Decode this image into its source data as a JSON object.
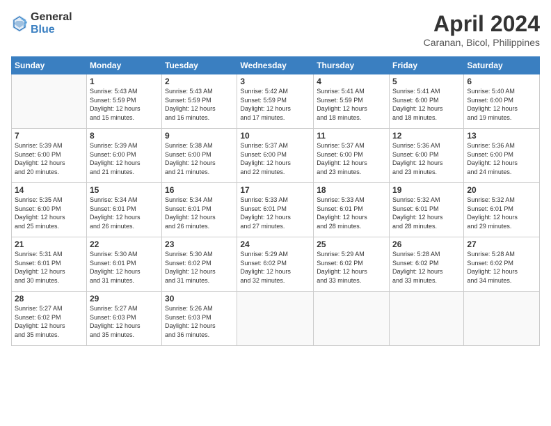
{
  "logo": {
    "general": "General",
    "blue": "Blue"
  },
  "title": "April 2024",
  "location": "Caranan, Bicol, Philippines",
  "headers": [
    "Sunday",
    "Monday",
    "Tuesday",
    "Wednesday",
    "Thursday",
    "Friday",
    "Saturday"
  ],
  "weeks": [
    [
      {
        "day": "",
        "info": ""
      },
      {
        "day": "1",
        "info": "Sunrise: 5:43 AM\nSunset: 5:59 PM\nDaylight: 12 hours\nand 15 minutes."
      },
      {
        "day": "2",
        "info": "Sunrise: 5:43 AM\nSunset: 5:59 PM\nDaylight: 12 hours\nand 16 minutes."
      },
      {
        "day": "3",
        "info": "Sunrise: 5:42 AM\nSunset: 5:59 PM\nDaylight: 12 hours\nand 17 minutes."
      },
      {
        "day": "4",
        "info": "Sunrise: 5:41 AM\nSunset: 5:59 PM\nDaylight: 12 hours\nand 18 minutes."
      },
      {
        "day": "5",
        "info": "Sunrise: 5:41 AM\nSunset: 6:00 PM\nDaylight: 12 hours\nand 18 minutes."
      },
      {
        "day": "6",
        "info": "Sunrise: 5:40 AM\nSunset: 6:00 PM\nDaylight: 12 hours\nand 19 minutes."
      }
    ],
    [
      {
        "day": "7",
        "info": "Sunrise: 5:39 AM\nSunset: 6:00 PM\nDaylight: 12 hours\nand 20 minutes."
      },
      {
        "day": "8",
        "info": "Sunrise: 5:39 AM\nSunset: 6:00 PM\nDaylight: 12 hours\nand 21 minutes."
      },
      {
        "day": "9",
        "info": "Sunrise: 5:38 AM\nSunset: 6:00 PM\nDaylight: 12 hours\nand 21 minutes."
      },
      {
        "day": "10",
        "info": "Sunrise: 5:37 AM\nSunset: 6:00 PM\nDaylight: 12 hours\nand 22 minutes."
      },
      {
        "day": "11",
        "info": "Sunrise: 5:37 AM\nSunset: 6:00 PM\nDaylight: 12 hours\nand 23 minutes."
      },
      {
        "day": "12",
        "info": "Sunrise: 5:36 AM\nSunset: 6:00 PM\nDaylight: 12 hours\nand 23 minutes."
      },
      {
        "day": "13",
        "info": "Sunrise: 5:36 AM\nSunset: 6:00 PM\nDaylight: 12 hours\nand 24 minutes."
      }
    ],
    [
      {
        "day": "14",
        "info": "Sunrise: 5:35 AM\nSunset: 6:00 PM\nDaylight: 12 hours\nand 25 minutes."
      },
      {
        "day": "15",
        "info": "Sunrise: 5:34 AM\nSunset: 6:01 PM\nDaylight: 12 hours\nand 26 minutes."
      },
      {
        "day": "16",
        "info": "Sunrise: 5:34 AM\nSunset: 6:01 PM\nDaylight: 12 hours\nand 26 minutes."
      },
      {
        "day": "17",
        "info": "Sunrise: 5:33 AM\nSunset: 6:01 PM\nDaylight: 12 hours\nand 27 minutes."
      },
      {
        "day": "18",
        "info": "Sunrise: 5:33 AM\nSunset: 6:01 PM\nDaylight: 12 hours\nand 28 minutes."
      },
      {
        "day": "19",
        "info": "Sunrise: 5:32 AM\nSunset: 6:01 PM\nDaylight: 12 hours\nand 28 minutes."
      },
      {
        "day": "20",
        "info": "Sunrise: 5:32 AM\nSunset: 6:01 PM\nDaylight: 12 hours\nand 29 minutes."
      }
    ],
    [
      {
        "day": "21",
        "info": "Sunrise: 5:31 AM\nSunset: 6:01 PM\nDaylight: 12 hours\nand 30 minutes."
      },
      {
        "day": "22",
        "info": "Sunrise: 5:30 AM\nSunset: 6:01 PM\nDaylight: 12 hours\nand 31 minutes."
      },
      {
        "day": "23",
        "info": "Sunrise: 5:30 AM\nSunset: 6:02 PM\nDaylight: 12 hours\nand 31 minutes."
      },
      {
        "day": "24",
        "info": "Sunrise: 5:29 AM\nSunset: 6:02 PM\nDaylight: 12 hours\nand 32 minutes."
      },
      {
        "day": "25",
        "info": "Sunrise: 5:29 AM\nSunset: 6:02 PM\nDaylight: 12 hours\nand 33 minutes."
      },
      {
        "day": "26",
        "info": "Sunrise: 5:28 AM\nSunset: 6:02 PM\nDaylight: 12 hours\nand 33 minutes."
      },
      {
        "day": "27",
        "info": "Sunrise: 5:28 AM\nSunset: 6:02 PM\nDaylight: 12 hours\nand 34 minutes."
      }
    ],
    [
      {
        "day": "28",
        "info": "Sunrise: 5:27 AM\nSunset: 6:02 PM\nDaylight: 12 hours\nand 35 minutes."
      },
      {
        "day": "29",
        "info": "Sunrise: 5:27 AM\nSunset: 6:03 PM\nDaylight: 12 hours\nand 35 minutes."
      },
      {
        "day": "30",
        "info": "Sunrise: 5:26 AM\nSunset: 6:03 PM\nDaylight: 12 hours\nand 36 minutes."
      },
      {
        "day": "",
        "info": ""
      },
      {
        "day": "",
        "info": ""
      },
      {
        "day": "",
        "info": ""
      },
      {
        "day": "",
        "info": ""
      }
    ]
  ]
}
